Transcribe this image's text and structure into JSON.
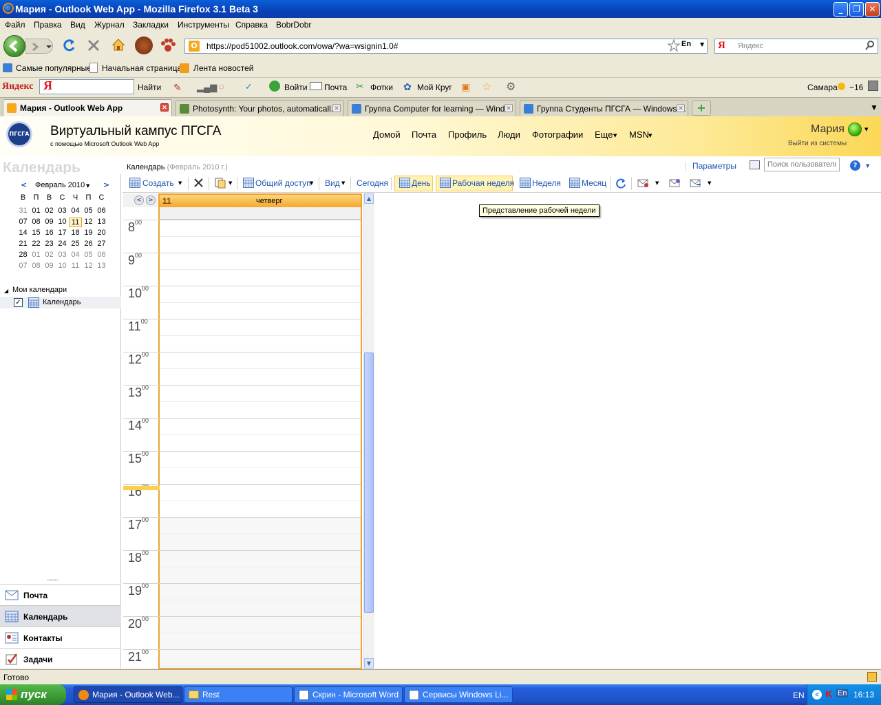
{
  "window": {
    "title": "Мария - Outlook Web App - Mozilla Firefox 3.1 Beta 3",
    "minimize": "_",
    "maximize": "❐",
    "close": "✕"
  },
  "menu": [
    "Файл",
    "Правка",
    "Вид",
    "Журнал",
    "Закладки",
    "Инструменты",
    "Справка",
    "BobrDobr"
  ],
  "nav": {
    "url": "https://pod51002.outlook.com/owa/?wa=wsignin1.0#",
    "lang_badge": "En",
    "search_placeholder": "Яндекс"
  },
  "bookmarks": [
    "Самые популярные",
    "Начальная страница",
    "Лента новостей"
  ],
  "yandex_bar": {
    "brand": "Яндекс",
    "logo": "Я",
    "find": "Найти",
    "login": "Войти",
    "mail": "Почта",
    "photos": "Фотки",
    "circle": "Мой Круг",
    "city": "Самара",
    "temp": "−16"
  },
  "tabs": [
    {
      "label": "Мария - Outlook Web App"
    },
    {
      "label": "Photosynth: Your photos, automaticall..."
    },
    {
      "label": "Группа Computer for learning — Wind..."
    },
    {
      "label": "Группа Студенты ПГСГА — Windows ..."
    }
  ],
  "owa": {
    "site_title": "Виртуальный кампус ПГСГА",
    "site_subtitle": "с помощью Microsoft Outlook Web App",
    "logo_text": "ПГСГА",
    "topnav": [
      "Домой",
      "Почта",
      "Профиль",
      "Люди",
      "Фотографии",
      "Еще",
      "MSN"
    ],
    "user": "Мария",
    "signout": "Выйти из системы",
    "big_title": "Календарь",
    "breadcrumb": "Календарь",
    "breadcrumb_sub": "(Февраль 2010 г.)",
    "params": "Параметры",
    "find_user_placeholder": "Поиск пользователя"
  },
  "toolbar": {
    "create": "Создать",
    "share": "Общий доступ",
    "view": "Вид",
    "today": "Сегодня",
    "day": "День",
    "workweek": "Рабочая неделя",
    "week": "Неделя",
    "month": "Месяц",
    "tooltip": "Представление рабочей недели"
  },
  "minical": {
    "month": "Февраль 2010",
    "weekdays": [
      "В",
      "П",
      "В",
      "С",
      "Ч",
      "П",
      "С"
    ],
    "weeks": [
      [
        "31",
        "01",
        "02",
        "03",
        "04",
        "05",
        "06"
      ],
      [
        "07",
        "08",
        "09",
        "10",
        "11",
        "12",
        "13"
      ],
      [
        "14",
        "15",
        "16",
        "17",
        "18",
        "19",
        "20"
      ],
      [
        "21",
        "22",
        "23",
        "24",
        "25",
        "26",
        "27"
      ],
      [
        "28",
        "01",
        "02",
        "03",
        "04",
        "05",
        "06"
      ],
      [
        "07",
        "08",
        "09",
        "10",
        "11",
        "12",
        "13"
      ]
    ],
    "today": "11"
  },
  "folders": {
    "group": "Мои календари",
    "calendar": "Календарь"
  },
  "left_nav": [
    "Почта",
    "Календарь",
    "Контакты",
    "Задачи"
  ],
  "day_view": {
    "day_number": "11",
    "day_name": "четверг",
    "hours": [
      "8",
      "9",
      "10",
      "11",
      "12",
      "13",
      "14",
      "15",
      "16",
      "17",
      "18",
      "19",
      "20",
      "21"
    ],
    "minutes": "00"
  },
  "status": "Готово",
  "taskbar": {
    "start": "пуск",
    "items": [
      "Мария - Outlook Web...",
      "Rest",
      "Скрин - Microsoft Word",
      "Сервисы Windows Li..."
    ],
    "lang": "EN",
    "tray_lang": "En",
    "clock": "16:13"
  },
  "colors": {
    "accent_orange": "#f0a22e",
    "link_blue": "#1d55b0",
    "xp_blue": "#0842b9"
  }
}
